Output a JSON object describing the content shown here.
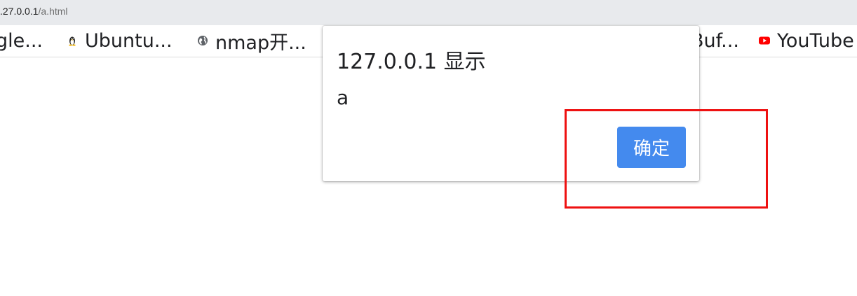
{
  "address_bar": {
    "host": ".27.0.0.1",
    "path": "/a.html"
  },
  "bookmarks": [
    {
      "label": "gle...",
      "icon": "none"
    },
    {
      "label": "Ubuntu...",
      "icon": "penguin-icon"
    },
    {
      "label": "nmap开...",
      "icon": "globe-icon"
    },
    {
      "label": "Buf...",
      "icon": "none"
    },
    {
      "label": "YouTube",
      "icon": "youtube-icon"
    }
  ],
  "dialog": {
    "title": "127.0.0.1 显示",
    "message": "a",
    "ok_label": "确定"
  },
  "colors": {
    "ok_button": "#448aee",
    "highlight": "#ee1111",
    "address_bar_bg": "#e8eaed"
  }
}
